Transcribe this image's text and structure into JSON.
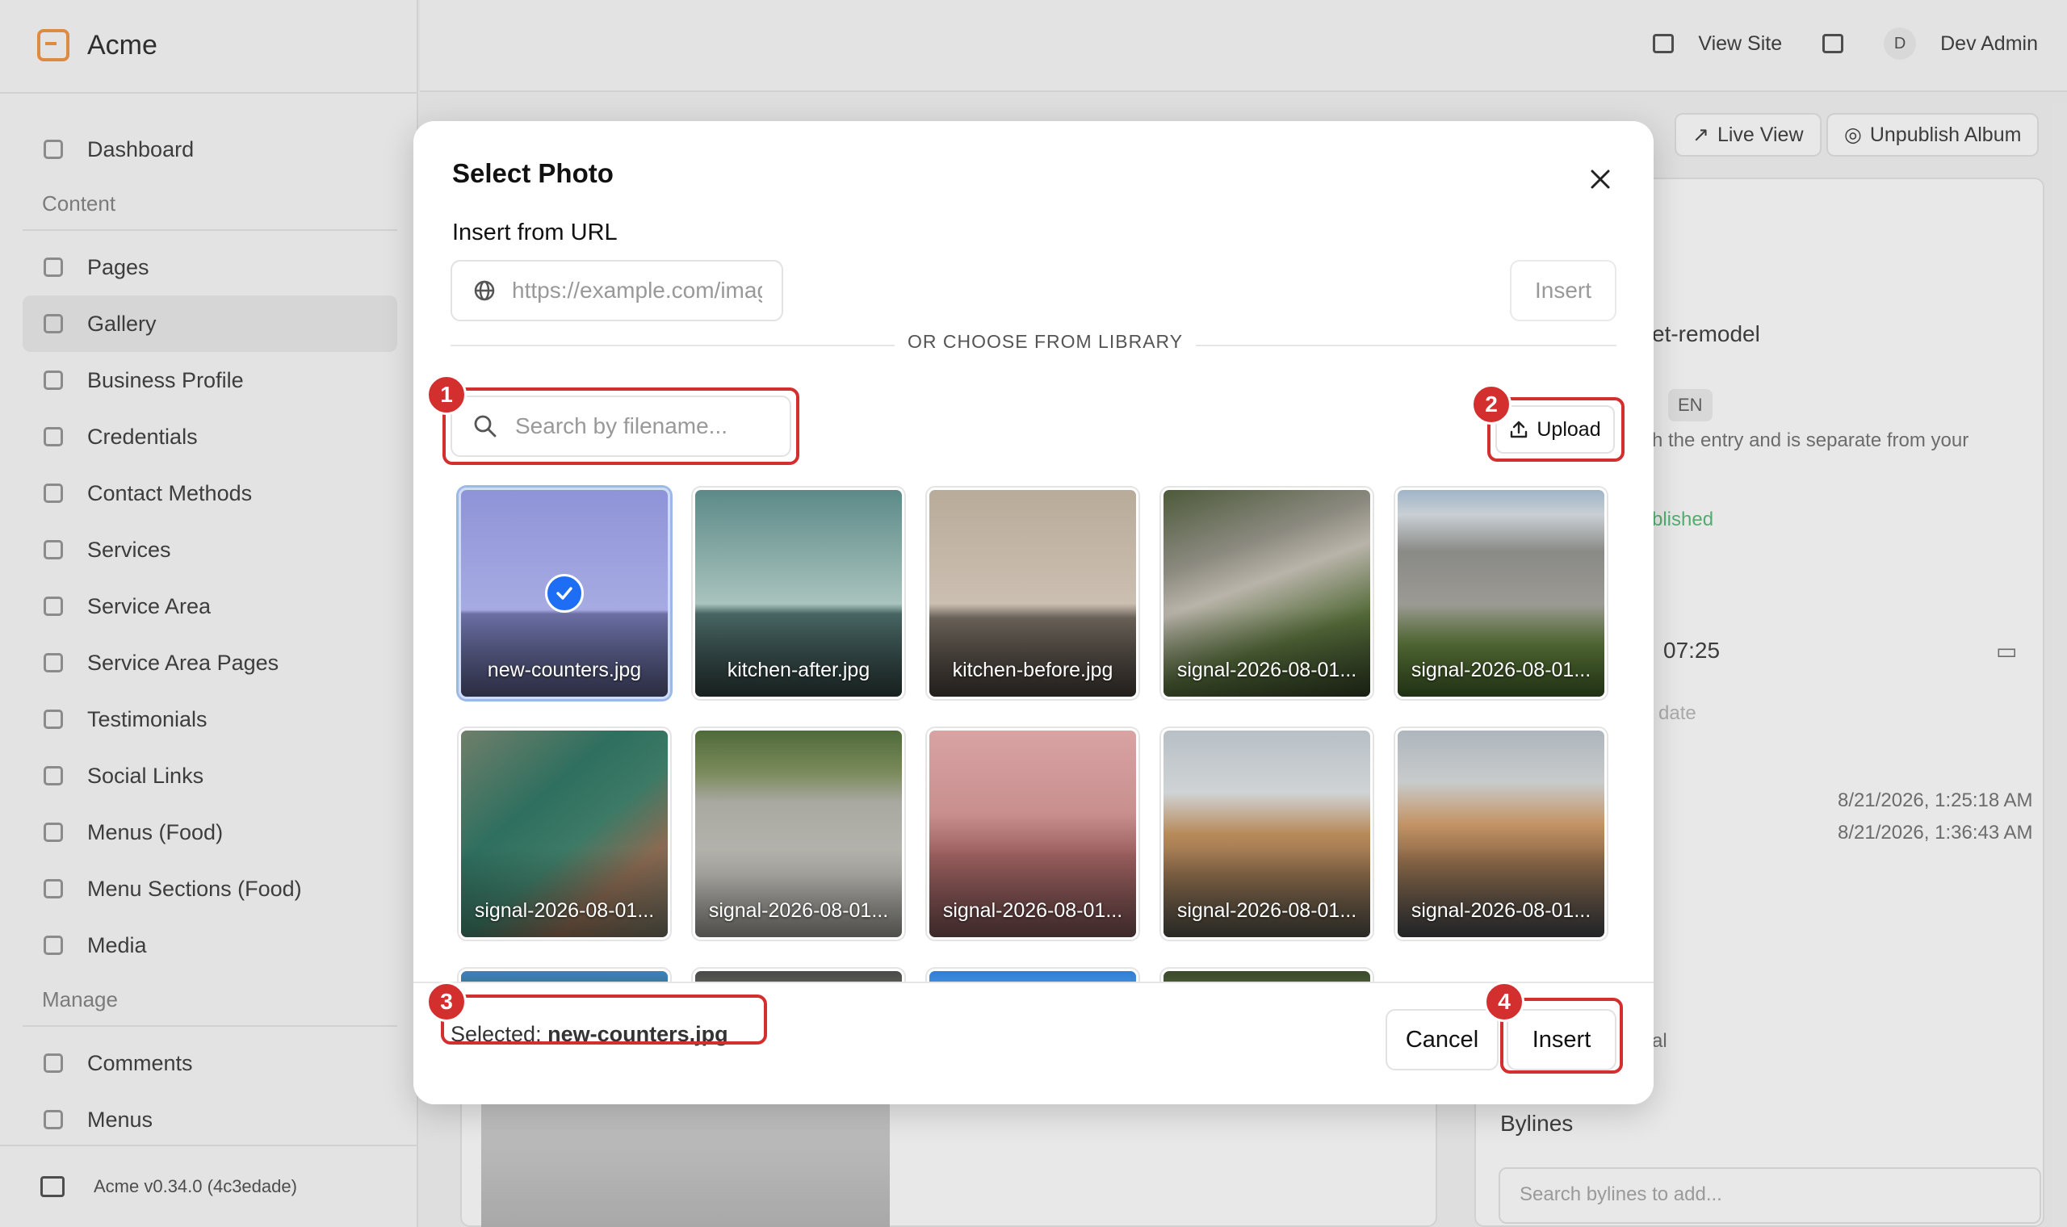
{
  "app": {
    "brand": "Acme",
    "version": "Acme v0.34.0 (4c3edade)"
  },
  "topbar": {
    "view_site": "View Site",
    "user_initial": "D",
    "user_name": "Dev Admin"
  },
  "sidebar": {
    "dashboard": "Dashboard",
    "content_section": "Content",
    "content_items": [
      {
        "label": "Pages"
      },
      {
        "label": "Gallery"
      },
      {
        "label": "Business Profile"
      },
      {
        "label": "Credentials"
      },
      {
        "label": "Contact Methods"
      },
      {
        "label": "Services"
      },
      {
        "label": "Service Area"
      },
      {
        "label": "Service Area Pages"
      },
      {
        "label": "Testimonials"
      },
      {
        "label": "Social Links"
      },
      {
        "label": "Menus (Food)"
      },
      {
        "label": "Menu Sections (Food)"
      },
      {
        "label": "Media"
      }
    ],
    "manage_section": "Manage",
    "manage_items": [
      {
        "label": "Comments"
      },
      {
        "label": "Menus"
      }
    ]
  },
  "background": {
    "live_view": "Live View",
    "unpublish": "Unpublish Album",
    "slug_fragment": "et-remodel",
    "locale_badge": "EN",
    "help_fragment": "h the entry and is separate from your",
    "status_fragment": "blished",
    "time_value": "07:25",
    "date_hint": "date",
    "created": "8/21/2026, 1:25:18 AM",
    "updated": "8/21/2026, 1:36:43 AM",
    "fragment_al": "al",
    "bylines_title": "Bylines",
    "bylines_placeholder": "Search bylines to add..."
  },
  "modal": {
    "title": "Select Photo",
    "url_label": "Insert from URL",
    "url_placeholder": "https://example.com/image.jpg",
    "url_insert": "Insert",
    "divider": "OR CHOOSE FROM LIBRARY",
    "search_placeholder": "Search by filename...",
    "upload": "Upload",
    "selected_prefix": "Selected: ",
    "selected_file": "new-counters.jpg",
    "cancel": "Cancel",
    "insert": "Insert"
  },
  "photos": [
    {
      "name": "new-counters.jpg",
      "selected": true
    },
    {
      "name": "kitchen-after.jpg",
      "selected": false
    },
    {
      "name": "kitchen-before.jpg",
      "selected": false
    },
    {
      "name": "signal-2026-08-01...",
      "selected": false
    },
    {
      "name": "signal-2026-08-01...",
      "selected": false
    },
    {
      "name": "signal-2026-08-01...",
      "selected": false
    },
    {
      "name": "signal-2026-08-01...",
      "selected": false
    },
    {
      "name": "signal-2026-08-01...",
      "selected": false
    },
    {
      "name": "signal-2026-08-01...",
      "selected": false
    },
    {
      "name": "signal-2026-08-01...",
      "selected": false
    },
    {
      "name": "",
      "selected": false
    },
    {
      "name": "",
      "selected": false
    },
    {
      "name": "",
      "selected": false
    },
    {
      "name": "",
      "selected": false
    }
  ],
  "annotations": [
    "1",
    "2",
    "3",
    "4"
  ],
  "colors": {
    "accent_blue": "#1d6ef5",
    "annotation_red": "#d32f2f",
    "brand_orange": "#f2994a"
  }
}
